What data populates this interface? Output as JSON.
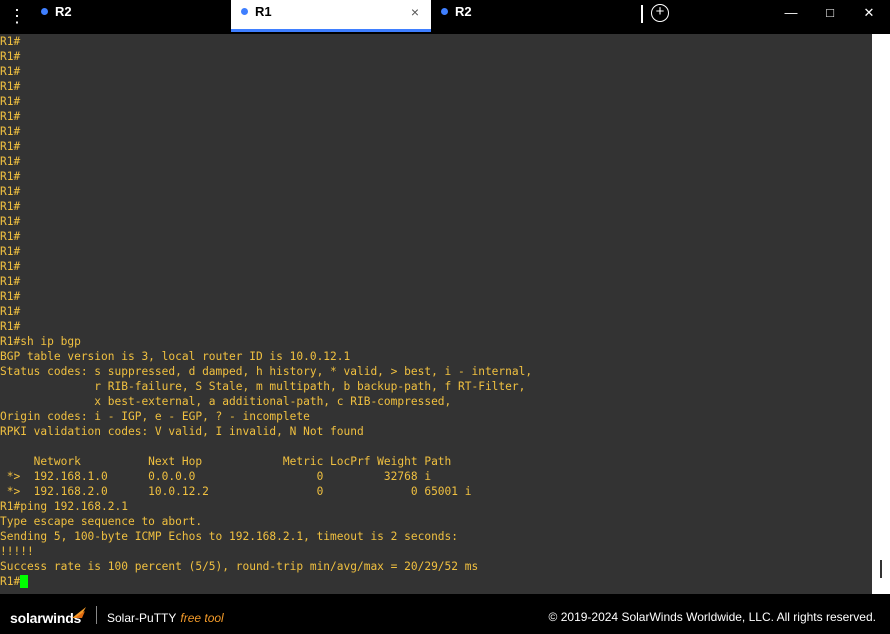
{
  "window": {
    "tabs": [
      {
        "label": "R2",
        "active": false
      },
      {
        "label": "R1",
        "active": true,
        "close": "×"
      },
      {
        "label": "R2",
        "active": false
      }
    ],
    "new_tab_icon": "plus-circle-icon",
    "controls": {
      "minimize": "—",
      "maximize": "□",
      "close": "✕"
    }
  },
  "terminal": {
    "text_color": "#f0c040",
    "background": "#333333",
    "lines": [
      "R1#",
      "R1#",
      "R1#",
      "R1#",
      "R1#",
      "R1#",
      "R1#",
      "R1#",
      "R1#",
      "R1#",
      "R1#",
      "R1#",
      "R1#",
      "R1#",
      "R1#",
      "R1#",
      "R1#",
      "R1#",
      "R1#",
      "R1#",
      "R1#sh ip bgp",
      "BGP table version is 3, local router ID is 10.0.12.1",
      "Status codes: s suppressed, d damped, h history, * valid, > best, i - internal,",
      "              r RIB-failure, S Stale, m multipath, b backup-path, f RT-Filter,",
      "              x best-external, a additional-path, c RIB-compressed,",
      "Origin codes: i - IGP, e - EGP, ? - incomplete",
      "RPKI validation codes: V valid, I invalid, N Not found",
      "",
      "     Network          Next Hop            Metric LocPrf Weight Path",
      " *>  192.168.1.0      0.0.0.0                  0         32768 i",
      " *>  192.168.2.0      10.0.12.2                0             0 65001 i",
      "R1#ping 192.168.2.1",
      "Type escape sequence to abort.",
      "Sending 5, 100-byte ICMP Echos to 192.168.2.1, timeout is 2 seconds:",
      "!!!!!",
      "Success rate is 100 percent (5/5), round-trip min/avg/max = 20/29/52 ms"
    ],
    "prompt": "R1#"
  },
  "footer": {
    "brand": "solarwinds",
    "product": "Solar-PuTTY",
    "free_label": "free tool",
    "copyright": "© 2019-2024 SolarWinds Worldwide, LLC. All rights reserved."
  }
}
